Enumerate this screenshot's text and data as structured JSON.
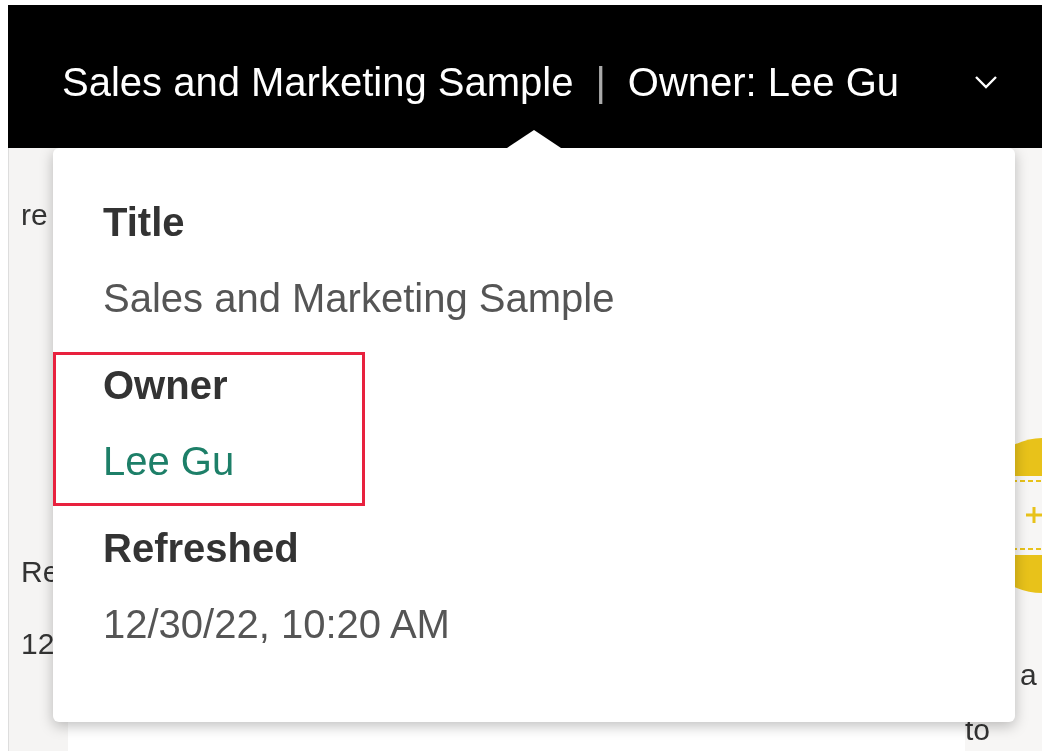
{
  "header": {
    "title": "Sales and Marketing Sample",
    "separator": "|",
    "owner": "Owner: Lee Gu"
  },
  "background": {
    "left_texts": [
      "re",
      "Re",
      "12"
    ],
    "right_texts": [
      "a",
      "to"
    ]
  },
  "popover": {
    "fields": [
      {
        "label": "Title",
        "value": "Sales and Marketing Sample",
        "kind": "text",
        "highlighted": false
      },
      {
        "label": "Owner",
        "value": "Lee Gu",
        "kind": "link",
        "highlighted": true
      },
      {
        "label": "Refreshed",
        "value": "12/30/22, 10:20 AM",
        "kind": "text",
        "highlighted": false
      }
    ]
  }
}
